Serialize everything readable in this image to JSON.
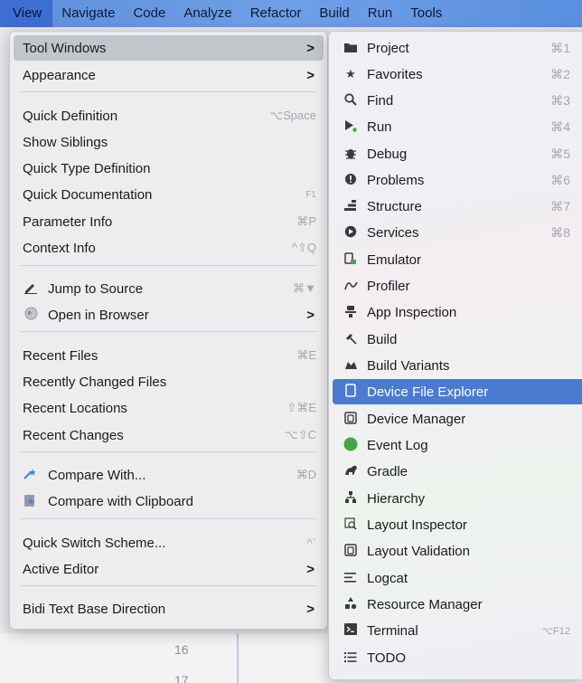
{
  "menubar": {
    "items": [
      "View",
      "Navigate",
      "Code",
      "Analyze",
      "Refactor",
      "Build",
      "Run",
      "Tools"
    ]
  },
  "view_menu": {
    "tool_windows": "Tool Windows",
    "appearance": "Appearance",
    "quick_definition": "Quick Definition",
    "quick_definition_shortcut": "⌥Space",
    "show_siblings": "Show Siblings",
    "quick_type_definition": "Quick Type Definition",
    "quick_documentation": "Quick Documentation",
    "quick_documentation_shortcut": "F1",
    "parameter_info": "Parameter Info",
    "parameter_info_shortcut": "⌘P",
    "context_info": "Context Info",
    "context_info_shortcut": "^⇧Q",
    "jump_to_source": "Jump to Source",
    "jump_to_source_shortcut": "⌘▼",
    "open_in_browser": "Open in Browser",
    "recent_files": "Recent Files",
    "recent_files_shortcut": "⌘E",
    "recently_changed_files": "Recently Changed Files",
    "recent_locations": "Recent Locations",
    "recent_locations_shortcut": "⇧⌘E",
    "recent_changes": "Recent Changes",
    "recent_changes_shortcut": "⌥⇧C",
    "compare_with": "Compare With...",
    "compare_with_shortcut": "⌘D",
    "compare_with_clipboard": "Compare with Clipboard",
    "quick_switch_scheme": "Quick Switch Scheme...",
    "quick_switch_scheme_shortcut": "^`",
    "active_editor": "Active Editor",
    "bidi_text": "Bidi Text Base Direction",
    "arrow": ">"
  },
  "tool_windows_submenu": [
    {
      "label": "Project",
      "shortcut": "⌘1",
      "icon": "folder-icon"
    },
    {
      "label": "Favorites",
      "shortcut": "⌘2",
      "icon": "star-icon"
    },
    {
      "label": "Find",
      "shortcut": "⌘3",
      "icon": "search-icon"
    },
    {
      "label": "Run",
      "shortcut": "⌘4",
      "icon": "run-icon"
    },
    {
      "label": "Debug",
      "shortcut": "⌘5",
      "icon": "bug-icon"
    },
    {
      "label": "Problems",
      "shortcut": "⌘6",
      "icon": "problems-icon"
    },
    {
      "label": "Structure",
      "shortcut": "⌘7",
      "icon": "structure-icon"
    },
    {
      "label": "Services",
      "shortcut": "⌘8",
      "icon": "services-icon"
    },
    {
      "label": "Emulator",
      "shortcut": "",
      "icon": "emulator-icon"
    },
    {
      "label": "Profiler",
      "shortcut": "",
      "icon": "profiler-icon"
    },
    {
      "label": "App Inspection",
      "shortcut": "",
      "icon": "app-inspection-icon"
    },
    {
      "label": "Build",
      "shortcut": "",
      "icon": "hammer-icon"
    },
    {
      "label": "Build Variants",
      "shortcut": "",
      "icon": "build-variants-icon"
    },
    {
      "label": "Device File Explorer",
      "shortcut": "",
      "icon": "device-icon"
    },
    {
      "label": "Device Manager",
      "shortcut": "",
      "icon": "device-manager-icon"
    },
    {
      "label": "Event Log",
      "shortcut": "",
      "icon": "event-log-icon"
    },
    {
      "label": "Gradle",
      "shortcut": "",
      "icon": "gradle-icon"
    },
    {
      "label": "Hierarchy",
      "shortcut": "",
      "icon": "hierarchy-icon"
    },
    {
      "label": "Layout Inspector",
      "shortcut": "",
      "icon": "layout-inspector-icon"
    },
    {
      "label": "Layout Validation",
      "shortcut": "",
      "icon": "layout-validation-icon"
    },
    {
      "label": "Logcat",
      "shortcut": "",
      "icon": "logcat-icon"
    },
    {
      "label": "Resource Manager",
      "shortcut": "",
      "icon": "resource-manager-icon"
    },
    {
      "label": "Terminal",
      "shortcut": "⌥F12",
      "icon": "terminal-icon"
    },
    {
      "label": "TODO",
      "shortcut": "",
      "icon": "todo-icon"
    }
  ],
  "editor": {
    "line_number": "16",
    "line_number_next": "17"
  },
  "colors": {
    "menubar": "#6da0e6",
    "highlight": "#4a7bd0"
  }
}
